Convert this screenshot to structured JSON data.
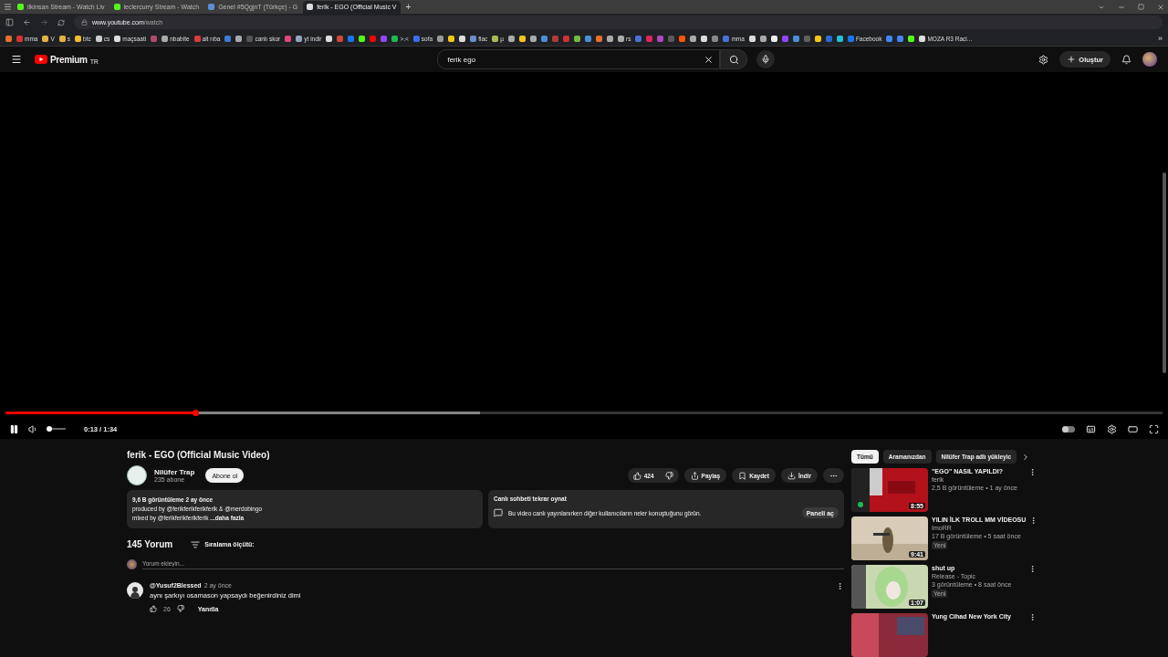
{
  "browser": {
    "tabs": [
      {
        "title": "ilkinsan Stream - Watch Liv",
        "selected": false,
        "color": "#53fc18"
      },
      {
        "title": "leclercurry Stream - Watch",
        "selected": false,
        "color": "#53fc18"
      },
      {
        "title": "Genel #5QgjnT (Türkçe) - G",
        "selected": false,
        "color": "#5a8fd8"
      },
      {
        "title": "ferik - EGO (Official Music V",
        "selected": true,
        "color": "#dddddd"
      }
    ],
    "new_tab": "+",
    "url_host": "www.youtube.com",
    "url_path": "/watch",
    "bookmarks": [
      {
        "color": "#e8702a"
      },
      {
        "label": "mma",
        "color": "#d9322f"
      },
      {
        "label": "V",
        "color": "#e3b341"
      },
      {
        "label": "s",
        "color": "#e3b341"
      },
      {
        "label": "btc",
        "color": "#f3ba2f"
      },
      {
        "label": "cs",
        "color": "#cccccc"
      },
      {
        "label": "maçsaati",
        "color": "#dddddd"
      },
      {
        "color": "#b04a6a"
      },
      {
        "label": "nbabite",
        "color": "#aaaaaa"
      },
      {
        "label": "alt rıba",
        "color": "#e03a3a"
      },
      {
        "color": "#3b7dd8"
      },
      {
        "color": "#aaaaaa"
      },
      {
        "label": "canlı skor",
        "color": "#555555"
      },
      {
        "color": "#e0457b"
      },
      {
        "label": "yt indir",
        "color": "#8fa6b8"
      },
      {
        "color": "#dddddd"
      },
      {
        "color": "#d14836"
      },
      {
        "color": "#1877f2"
      },
      {
        "color": "#53fc18"
      },
      {
        "color": "#ff0000"
      },
      {
        "color": "#9146ff"
      },
      {
        "label": ">.<",
        "color": "#1db954"
      },
      {
        "label": "sofa",
        "color": "#3c6df0"
      },
      {
        "color": "#999999"
      },
      {
        "color": "#f5c518"
      },
      {
        "color": "#dddddd"
      },
      {
        "label": "flac",
        "color": "#6a8fc8"
      },
      {
        "label": "µ",
        "color": "#aabb55"
      },
      {
        "color": "#aaaaaa"
      },
      {
        "color": "#f5c518"
      },
      {
        "color": "#aaaaaa"
      },
      {
        "color": "#4a90d9"
      },
      {
        "color": "#b03a3a"
      },
      {
        "color": "#cc3333"
      },
      {
        "color": "#6fbf40"
      },
      {
        "color": "#4a90d9"
      },
      {
        "color": "#e8702a"
      },
      {
        "color": "#aaaaaa"
      },
      {
        "label": "rs",
        "color": "#aaaaaa"
      },
      {
        "color": "#4a70d9"
      },
      {
        "color": "#e0245e"
      },
      {
        "color": "#b04ac0"
      },
      {
        "color": "#5a5a5a"
      },
      {
        "color": "#ff5500"
      },
      {
        "color": "#aaaaaa"
      },
      {
        "color": "#dddddd"
      },
      {
        "color": "#888888"
      },
      {
        "label": "mma",
        "color": "#4a70d9"
      },
      {
        "color": "#dddddd"
      },
      {
        "color": "#aaaaaa"
      },
      {
        "color": "#eeeeee"
      },
      {
        "color": "#9146ff"
      },
      {
        "color": "#4a90d9"
      },
      {
        "color": "#606060"
      },
      {
        "color": "#f5c518"
      },
      {
        "color": "#2a6ad9"
      },
      {
        "color": "#23c0d8"
      },
      {
        "label": "Facebook",
        "color": "#1877f2"
      },
      {
        "color": "#4285f4"
      },
      {
        "color": "#4285f4"
      },
      {
        "color": "#53fc18"
      },
      {
        "label": "MOZA R3 Raci...",
        "color": "#dddddd"
      }
    ],
    "bookmarks_more": "»"
  },
  "youtube": {
    "logo": "Premium",
    "region": "TR",
    "search_value": "ferik ego",
    "create": "Oluştur",
    "player": {
      "level": 0.164,
      "buffer": {
        "level": 0.41
      },
      "volume": {
        "level": 0.1
      },
      "playing": true,
      "autoplay": false,
      "time": "0:13 / 1:34"
    },
    "video": {
      "title": "ferik - EGO (Official Music Video)",
      "channel": "Nilüfer Trap",
      "subscribers": "235 abone",
      "subscribe": "Abone ol",
      "likes": "424",
      "share": "Paylaş",
      "save": "Kaydet",
      "download": "İndir",
      "description": {
        "meta": "9,6 B görüntüleme  2 ay önce",
        "lines": [
          "produced by @ferikferikferikferik & @merdobingo",
          "mixed by @ferikferikferikferik"
        ],
        "more": "...daha fazla"
      },
      "chat": {
        "title": "Canlı sohbeti tekrar oynat",
        "text": "Bu video canlı yayınlanırken diğer kullanıcıların neler konuştuğunu görün.",
        "button": "Paneli aç"
      }
    },
    "comments": {
      "count": "145 Yorum",
      "sort": "Sıralama ölçütü:",
      "placeholder": "Yorum ekleyin...",
      "items": [
        {
          "author": "@Yusuf2Blessed",
          "time": "2 ay önce",
          "text": "aynı şarkıyı osamason yapsaydı beğenirdiniz dimi",
          "likes": "26",
          "reply": "Yanıtla"
        }
      ]
    },
    "chips": [
      {
        "label": "Tümü",
        "selected": true
      },
      {
        "label": "Aramanızdan",
        "selected": false
      },
      {
        "label": "Nilüfer Trap adlı yükleyic",
        "selected": false
      }
    ],
    "related": [
      {
        "title": "\"EGO\" NASIL YAPILDI?",
        "channel": "ferik",
        "meta": "2,5 B görüntüleme • 1 ay önce",
        "duration": "8:55",
        "new": false,
        "color": "#b3121b"
      },
      {
        "title": "YILIN İLK TROLL MM VİDEOSU",
        "channel": "ImoRR",
        "meta": "17 B görüntüleme • 5 saat önce",
        "duration": "9:41",
        "new": true,
        "badge": "Yeni",
        "color": "#d8cbb8"
      },
      {
        "title": "shut up",
        "channel": "Release - Topic",
        "meta": "3 görüntüleme • 8 saat önce",
        "duration": "1:07",
        "new": true,
        "badge": "Yeni",
        "color": "#c8d8b0"
      },
      {
        "title": "Yung Cihad New York City",
        "color": "#8a2a3a"
      }
    ]
  }
}
